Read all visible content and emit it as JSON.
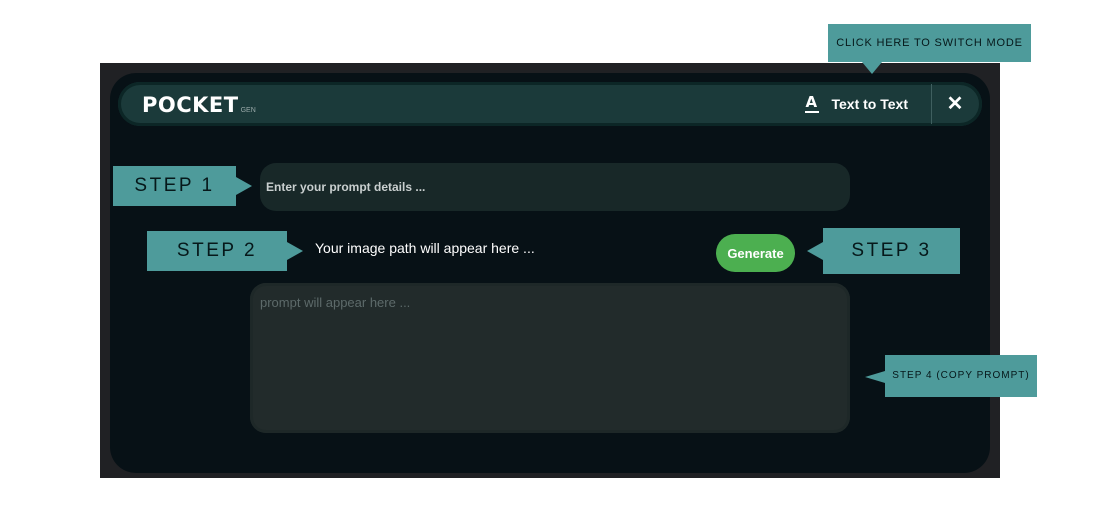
{
  "header": {
    "logo_text": "POCKET",
    "logo_sub": "GEN",
    "mode_icon": "text-format-icon",
    "mode_label": "Text to Text",
    "close_glyph": "✕"
  },
  "prompt_input": {
    "placeholder": "Enter your prompt details ...",
    "value": ""
  },
  "image_path_text": "Your image path will appear here ...",
  "generate_label": "Generate",
  "output": {
    "placeholder": "prompt will appear here ..."
  },
  "callouts": {
    "switch_mode": "CLICK HERE TO SWITCH MODE",
    "step1": "STEP 1",
    "step2": "STEP 2",
    "step3": "STEP 3",
    "step4": "STEP 4 (COPY PROMPT)"
  },
  "colors": {
    "panel": "#071116",
    "header": "#1b3a3a",
    "accent": "#4e9b9b",
    "generate": "#4caf50"
  }
}
